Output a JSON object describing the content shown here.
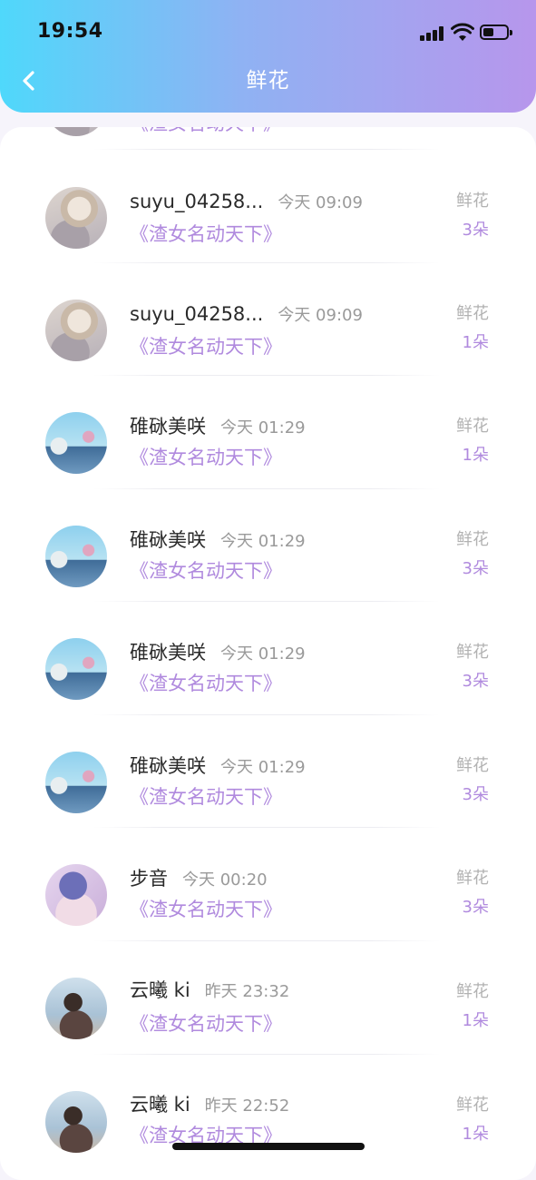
{
  "status_bar": {
    "time": "19:54"
  },
  "nav": {
    "title": "鲜花"
  },
  "partial_row": {
    "book": "《渣女名动天下》"
  },
  "rows": [
    {
      "name": "suyu_04258...",
      "time": "今天 09:09",
      "book": "《渣女名动天下》",
      "gift": "鲜花",
      "count": "3朵",
      "avatar": "avatar-anime-boy"
    },
    {
      "name": "suyu_04258...",
      "time": "今天 09:09",
      "book": "《渣女名动天下》",
      "gift": "鲜花",
      "count": "1朵",
      "avatar": "avatar-anime-boy"
    },
    {
      "name": "碓砯美咲",
      "time": "今天 01:29",
      "book": "《渣女名动天下》",
      "gift": "鲜花",
      "count": "1朵",
      "avatar": "avatar-anime-sky"
    },
    {
      "name": "碓砯美咲",
      "time": "今天 01:29",
      "book": "《渣女名动天下》",
      "gift": "鲜花",
      "count": "3朵",
      "avatar": "avatar-anime-sky"
    },
    {
      "name": "碓砯美咲",
      "time": "今天 01:29",
      "book": "《渣女名动天下》",
      "gift": "鲜花",
      "count": "3朵",
      "avatar": "avatar-anime-sky"
    },
    {
      "name": "碓砯美咲",
      "time": "今天 01:29",
      "book": "《渣女名动天下》",
      "gift": "鲜花",
      "count": "3朵",
      "avatar": "avatar-anime-sky"
    },
    {
      "name": "步音",
      "time": "今天 00:20",
      "book": "《渣女名动天下》",
      "gift": "鲜花",
      "count": "3朵",
      "avatar": "avatar-anime-girl"
    },
    {
      "name": "云曦 ki",
      "time": "昨天 23:32",
      "book": "《渣女名动天下》",
      "gift": "鲜花",
      "count": "1朵",
      "avatar": "avatar-photo-woman"
    },
    {
      "name": "云曦 ki",
      "time": "昨天 22:52",
      "book": "《渣女名动天下》",
      "gift": "鲜花",
      "count": "1朵",
      "avatar": "avatar-photo-woman"
    }
  ],
  "colors": {
    "header_start": "#4fd8fb",
    "header_end": "#b796ec",
    "accent": "#b08ade"
  }
}
